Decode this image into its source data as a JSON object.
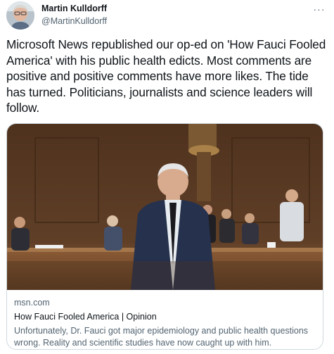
{
  "author": {
    "display_name": "Martin Kulldorff",
    "handle": "@MartinKulldorff"
  },
  "tweet": {
    "text": "Microsoft News republished our op-ed on 'How Fauci Fooled America' with his public health edicts. Most comments are positive and positive comments have more likes. The tide has turned. Politicians, journalists and science leaders will follow."
  },
  "link_card": {
    "domain": "msn.com",
    "title": "How Fauci Fooled America | Opinion",
    "description": "Unfortunately, Dr. Fauci got major epidemiology and public health questions wrong. Reality and scientific studies have now caught up with him."
  },
  "icons": {
    "more": "more-options-icon"
  },
  "colors": {
    "text_primary": "#0f1419",
    "text_secondary": "#536471",
    "card_border": "#cfd9de"
  }
}
